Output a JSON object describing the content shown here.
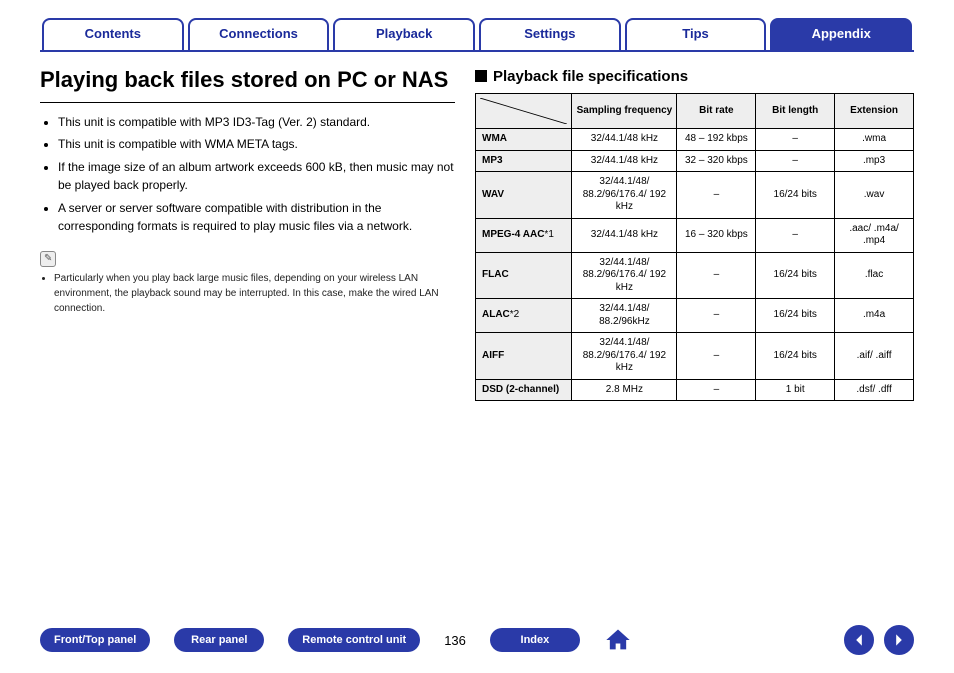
{
  "tabs": {
    "contents": "Contents",
    "connections": "Connections",
    "playback": "Playback",
    "settings": "Settings",
    "tips": "Tips",
    "appendix": "Appendix"
  },
  "heading": "Playing back files stored on PC or NAS",
  "bullets": [
    "This unit is compatible with MP3 ID3-Tag (Ver. 2) standard.",
    "This unit is compatible with WMA META tags.",
    "If the image size of an album artwork exceeds 600 kB, then music may not be played back properly.",
    "A server or server software compatible with distribution in the corresponding formats is required to play music files via a network."
  ],
  "note_icon": "✎",
  "notes": [
    "Particularly when you play back large music files, depending on your wireless LAN environment, the playback sound may be interrupted. In this case, make the wired LAN connection."
  ],
  "subheading": "Playback file specifications",
  "table": {
    "headers": {
      "sampling": "Sampling frequency",
      "bitrate": "Bit rate",
      "bitlength": "Bit length",
      "extension": "Extension"
    },
    "rows": [
      {
        "format": "WMA",
        "sampling": "32/44.1/48 kHz",
        "bitrate": "48 – 192 kbps",
        "bitlength": "–",
        "ext": ".wma"
      },
      {
        "format": "MP3",
        "sampling": "32/44.1/48 kHz",
        "bitrate": "32 – 320 kbps",
        "bitlength": "–",
        "ext": ".mp3"
      },
      {
        "format": "WAV",
        "sampling": "32/44.1/48/ 88.2/96/176.4/ 192 kHz",
        "bitrate": "–",
        "bitlength": "16/24 bits",
        "ext": ".wav"
      },
      {
        "format": "MPEG-4 AAC",
        "footnote": "*1",
        "sampling": "32/44.1/48 kHz",
        "bitrate": "16 – 320 kbps",
        "bitlength": "–",
        "ext": ".aac/ .m4a/ .mp4"
      },
      {
        "format": "FLAC",
        "sampling": "32/44.1/48/ 88.2/96/176.4/ 192 kHz",
        "bitrate": "–",
        "bitlength": "16/24 bits",
        "ext": ".flac"
      },
      {
        "format": "ALAC",
        "footnote": "*2",
        "sampling": "32/44.1/48/ 88.2/96kHz",
        "bitrate": "–",
        "bitlength": "16/24 bits",
        "ext": ".m4a"
      },
      {
        "format": "AIFF",
        "sampling": "32/44.1/48/ 88.2/96/176.4/ 192 kHz",
        "bitrate": "–",
        "bitlength": "16/24 bits",
        "ext": ".aif/ .aiff"
      },
      {
        "format": "DSD (2-channel)",
        "sampling": "2.8 MHz",
        "bitrate": "–",
        "bitlength": "1 bit",
        "ext": ".dsf/ .dff"
      }
    ]
  },
  "footer": {
    "front_top_panel": "Front/Top panel",
    "rear_panel": "Rear panel",
    "remote_control": "Remote control unit",
    "index": "Index",
    "page": "136"
  }
}
